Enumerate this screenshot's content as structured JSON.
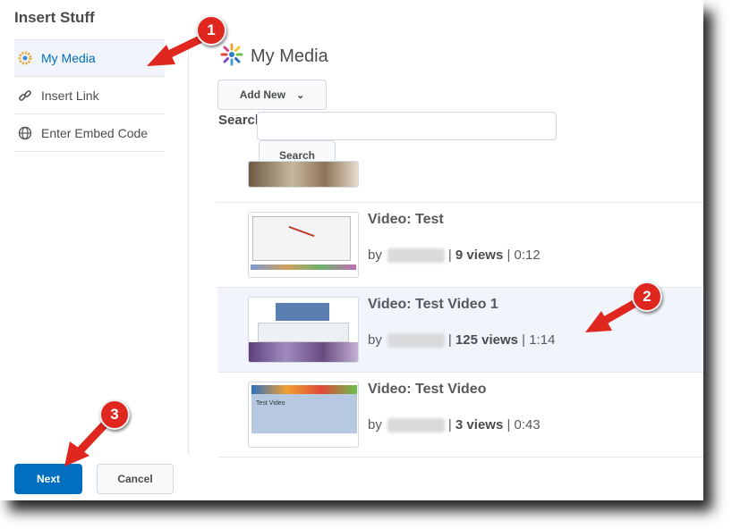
{
  "dialog": {
    "title": "Insert Stuff"
  },
  "sidebar": {
    "items": [
      {
        "label": "My Media",
        "icon": "my-media-logo-icon",
        "active": true
      },
      {
        "label": "Insert Link",
        "icon": "link-icon"
      },
      {
        "label": "Enter Embed Code",
        "icon": "globe-icon"
      }
    ]
  },
  "main": {
    "title": "My Media",
    "add_new_label": "Add New",
    "search_label": "Search:",
    "search_value": "",
    "search_button": "Search",
    "videos": [
      {
        "title": "Video: Test",
        "by": "by",
        "views": "9 views",
        "duration": "0:12"
      },
      {
        "title": "Video: Test Video 1",
        "by": "by",
        "views": "125 views",
        "duration": "1:14"
      },
      {
        "title": "Video: Test Video",
        "by": "by",
        "views": "3 views",
        "duration": "0:43"
      }
    ]
  },
  "footer": {
    "next_label": "Next",
    "cancel_label": "Cancel"
  },
  "annotations": {
    "step1": "1",
    "step2": "2",
    "step3": "3"
  },
  "colors": {
    "accent": "#006fbf",
    "annotation": "#e0271f",
    "highlight": "#f1f5fb"
  }
}
